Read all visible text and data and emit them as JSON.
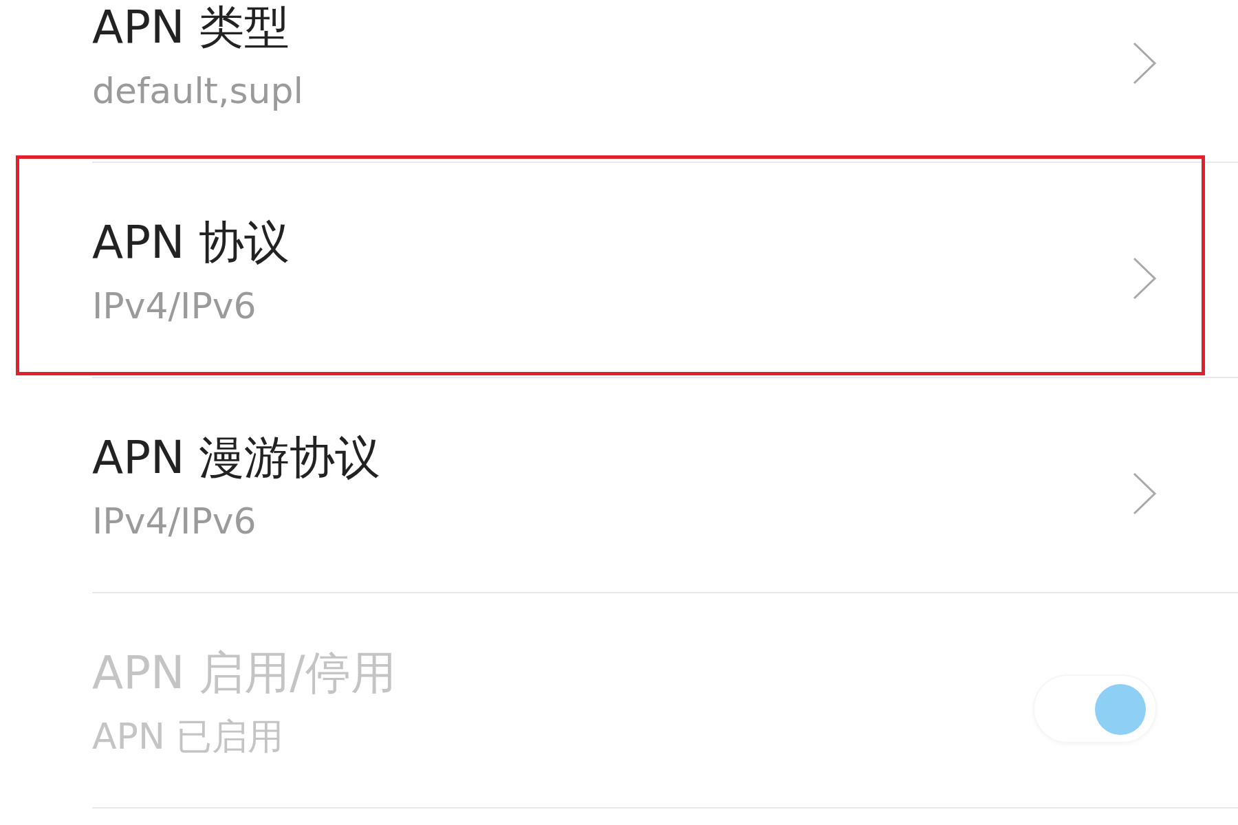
{
  "rows": [
    {
      "kind": "link",
      "title": "APN 类型",
      "value": "default,supl",
      "highlighted": false,
      "disabled": false
    },
    {
      "kind": "link",
      "title": "APN 协议",
      "value": "IPv4/IPv6",
      "highlighted": true,
      "disabled": false
    },
    {
      "kind": "link",
      "title": "APN 漫游协议",
      "value": "IPv4/IPv6",
      "highlighted": false,
      "disabled": false
    },
    {
      "kind": "toggle",
      "title": "APN 启用/停用",
      "value": "APN 已启用",
      "highlighted": false,
      "disabled": true,
      "on": true
    }
  ]
}
